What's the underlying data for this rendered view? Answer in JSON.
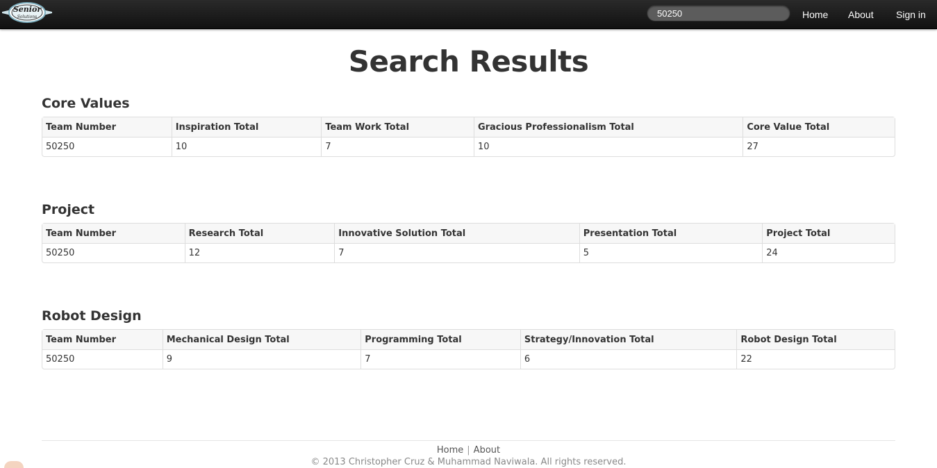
{
  "navbar": {
    "logo_text": "Senior Solutions",
    "search_value": "50250",
    "links": {
      "home": "Home",
      "about": "About",
      "signin": "Sign in"
    }
  },
  "page_title": "Search Results",
  "sections": {
    "core_values": {
      "title": "Core Values",
      "headers": [
        "Team Number",
        "Inspiration Total",
        "Team Work Total",
        "Gracious Professionalism Total",
        "Core Value Total"
      ],
      "row": [
        "50250",
        "10",
        "7",
        "10",
        "27"
      ]
    },
    "project": {
      "title": "Project",
      "headers": [
        "Team Number",
        "Research Total",
        "Innovative Solution Total",
        "Presentation Total",
        "Project Total"
      ],
      "row": [
        "50250",
        "12",
        "7",
        "5",
        "24"
      ]
    },
    "robot_design": {
      "title": "Robot Design",
      "headers": [
        "Team Number",
        "Mechanical Design Total",
        "Programming Total",
        "Strategy/Innovation Total",
        "Robot Design Total"
      ],
      "row": [
        "50250",
        "9",
        "7",
        "6",
        "22"
      ]
    }
  },
  "footer": {
    "links": {
      "home": "Home",
      "separator": "|",
      "about": "About"
    },
    "copyright": "© 2013 Christopher Cruz & Muhammad Naviwala. All rights reserved."
  },
  "colors": {
    "navbar_bg": "#1b1b1b",
    "text": "#333333",
    "table_border": "#dddddd",
    "table_header_bg": "#f7f7f7"
  }
}
